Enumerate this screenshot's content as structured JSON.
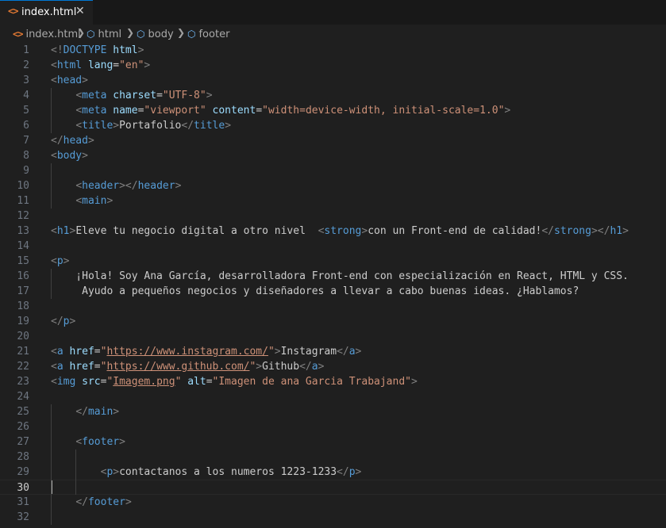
{
  "tab": {
    "icon": "<>",
    "label": "index.html",
    "close": "✕"
  },
  "breadcrumb": [
    "index.html",
    "html",
    "body",
    "footer"
  ],
  "active_line": 30,
  "lines": [
    {
      "n": "1",
      "tokens": [
        [
          "b",
          "<!"
        ],
        [
          "t",
          "DOCTYPE"
        ],
        [
          "x",
          " "
        ],
        [
          "a",
          "html"
        ],
        [
          "b",
          ">"
        ]
      ]
    },
    {
      "n": "2",
      "tokens": [
        [
          "b",
          "<"
        ],
        [
          "t",
          "html"
        ],
        [
          "x",
          " "
        ],
        [
          "a",
          "lang"
        ],
        [
          "x",
          "="
        ],
        [
          "s",
          "\"en\""
        ],
        [
          "b",
          ">"
        ]
      ]
    },
    {
      "n": "3",
      "tokens": [
        [
          "b",
          "<"
        ],
        [
          "t",
          "head"
        ],
        [
          "b",
          ">"
        ]
      ]
    },
    {
      "n": "4",
      "tokens": [
        [
          "x",
          "    "
        ],
        [
          "b",
          "<"
        ],
        [
          "t",
          "meta"
        ],
        [
          "x",
          " "
        ],
        [
          "a",
          "charset"
        ],
        [
          "x",
          "="
        ],
        [
          "s",
          "\"UTF-8\""
        ],
        [
          "b",
          ">"
        ]
      ]
    },
    {
      "n": "5",
      "tokens": [
        [
          "x",
          "    "
        ],
        [
          "b",
          "<"
        ],
        [
          "t",
          "meta"
        ],
        [
          "x",
          " "
        ],
        [
          "a",
          "name"
        ],
        [
          "x",
          "="
        ],
        [
          "s",
          "\"viewport\""
        ],
        [
          "x",
          " "
        ],
        [
          "a",
          "content"
        ],
        [
          "x",
          "="
        ],
        [
          "s",
          "\"width=device-width, initial-scale=1.0\""
        ],
        [
          "b",
          ">"
        ]
      ]
    },
    {
      "n": "6",
      "tokens": [
        [
          "x",
          "    "
        ],
        [
          "b",
          "<"
        ],
        [
          "t",
          "title"
        ],
        [
          "b",
          ">"
        ],
        [
          "x",
          "Portafolio"
        ],
        [
          "b",
          "</"
        ],
        [
          "t",
          "title"
        ],
        [
          "b",
          ">"
        ]
      ]
    },
    {
      "n": "7",
      "tokens": [
        [
          "b",
          "</"
        ],
        [
          "t",
          "head"
        ],
        [
          "b",
          ">"
        ]
      ]
    },
    {
      "n": "8",
      "tokens": [
        [
          "b",
          "<"
        ],
        [
          "t",
          "body"
        ],
        [
          "b",
          ">"
        ]
      ]
    },
    {
      "n": "9",
      "tokens": []
    },
    {
      "n": "10",
      "tokens": [
        [
          "x",
          "    "
        ],
        [
          "b",
          "<"
        ],
        [
          "t",
          "header"
        ],
        [
          "b",
          "></"
        ],
        [
          "t",
          "header"
        ],
        [
          "b",
          ">"
        ]
      ]
    },
    {
      "n": "11",
      "tokens": [
        [
          "x",
          "    "
        ],
        [
          "b",
          "<"
        ],
        [
          "t",
          "main"
        ],
        [
          "b",
          ">"
        ]
      ]
    },
    {
      "n": "12",
      "tokens": []
    },
    {
      "n": "13",
      "tokens": [
        [
          "b",
          "<"
        ],
        [
          "t",
          "h1"
        ],
        [
          "b",
          ">"
        ],
        [
          "x",
          "Eleve tu negocio digital a otro nivel  "
        ],
        [
          "b",
          "<"
        ],
        [
          "t",
          "strong"
        ],
        [
          "b",
          ">"
        ],
        [
          "x",
          "con un Front-end de calidad!"
        ],
        [
          "b",
          "</"
        ],
        [
          "t",
          "strong"
        ],
        [
          "b",
          "></"
        ],
        [
          "t",
          "h1"
        ],
        [
          "b",
          ">"
        ]
      ]
    },
    {
      "n": "14",
      "tokens": []
    },
    {
      "n": "15",
      "tokens": [
        [
          "b",
          "<"
        ],
        [
          "t",
          "p"
        ],
        [
          "b",
          ">"
        ]
      ]
    },
    {
      "n": "16",
      "tokens": [
        [
          "x",
          "    ¡Hola! Soy Ana García, desarrolladora Front-end con especialización en React, HTML y CSS."
        ]
      ]
    },
    {
      "n": "17",
      "tokens": [
        [
          "x",
          "     Ayudo a pequeños negocios y diseñadores a llevar a cabo buenas ideas. ¿Hablamos?"
        ]
      ]
    },
    {
      "n": "18",
      "tokens": []
    },
    {
      "n": "19",
      "tokens": [
        [
          "b",
          "</"
        ],
        [
          "t",
          "p"
        ],
        [
          "b",
          ">"
        ]
      ]
    },
    {
      "n": "20",
      "tokens": []
    },
    {
      "n": "21",
      "tokens": [
        [
          "b",
          "<"
        ],
        [
          "t",
          "a"
        ],
        [
          "x",
          " "
        ],
        [
          "a",
          "href"
        ],
        [
          "x",
          "="
        ],
        [
          "s",
          "\""
        ],
        [
          "u",
          "https://www.instagram.com/"
        ],
        [
          "s",
          "\""
        ],
        [
          "b",
          ">"
        ],
        [
          "x",
          "Instagram"
        ],
        [
          "b",
          "</"
        ],
        [
          "t",
          "a"
        ],
        [
          "b",
          ">"
        ]
      ]
    },
    {
      "n": "22",
      "tokens": [
        [
          "b",
          "<"
        ],
        [
          "t",
          "a"
        ],
        [
          "x",
          " "
        ],
        [
          "a",
          "href"
        ],
        [
          "x",
          "="
        ],
        [
          "s",
          "\""
        ],
        [
          "u",
          "https://www.github.com/"
        ],
        [
          "s",
          "\""
        ],
        [
          "b",
          ">"
        ],
        [
          "x",
          "Github"
        ],
        [
          "b",
          "</"
        ],
        [
          "t",
          "a"
        ],
        [
          "b",
          ">"
        ]
      ]
    },
    {
      "n": "23",
      "tokens": [
        [
          "b",
          "<"
        ],
        [
          "t",
          "img"
        ],
        [
          "x",
          " "
        ],
        [
          "a",
          "src"
        ],
        [
          "x",
          "="
        ],
        [
          "s",
          "\""
        ],
        [
          "u",
          "Imagem.png"
        ],
        [
          "s",
          "\""
        ],
        [
          "x",
          " "
        ],
        [
          "a",
          "alt"
        ],
        [
          "x",
          "="
        ],
        [
          "s",
          "\"Imagen de ana Garcia Trabajand\""
        ],
        [
          "b",
          ">"
        ]
      ]
    },
    {
      "n": "24",
      "tokens": []
    },
    {
      "n": "25",
      "tokens": [
        [
          "x",
          "    "
        ],
        [
          "b",
          "</"
        ],
        [
          "t",
          "main"
        ],
        [
          "b",
          ">"
        ]
      ]
    },
    {
      "n": "26",
      "tokens": []
    },
    {
      "n": "27",
      "tokens": [
        [
          "x",
          "    "
        ],
        [
          "b",
          "<"
        ],
        [
          "t",
          "footer"
        ],
        [
          "b",
          ">"
        ]
      ]
    },
    {
      "n": "28",
      "tokens": []
    },
    {
      "n": "29",
      "tokens": [
        [
          "x",
          "        "
        ],
        [
          "b",
          "<"
        ],
        [
          "t",
          "p"
        ],
        [
          "b",
          ">"
        ],
        [
          "x",
          "contactanos a los numeros 1223-1233"
        ],
        [
          "b",
          "</"
        ],
        [
          "t",
          "p"
        ],
        [
          "b",
          ">"
        ]
      ]
    },
    {
      "n": "30",
      "tokens": []
    },
    {
      "n": "31",
      "tokens": [
        [
          "x",
          "    "
        ],
        [
          "b",
          "</"
        ],
        [
          "t",
          "footer"
        ],
        [
          "b",
          ">"
        ]
      ]
    },
    {
      "n": "32",
      "tokens": []
    }
  ]
}
